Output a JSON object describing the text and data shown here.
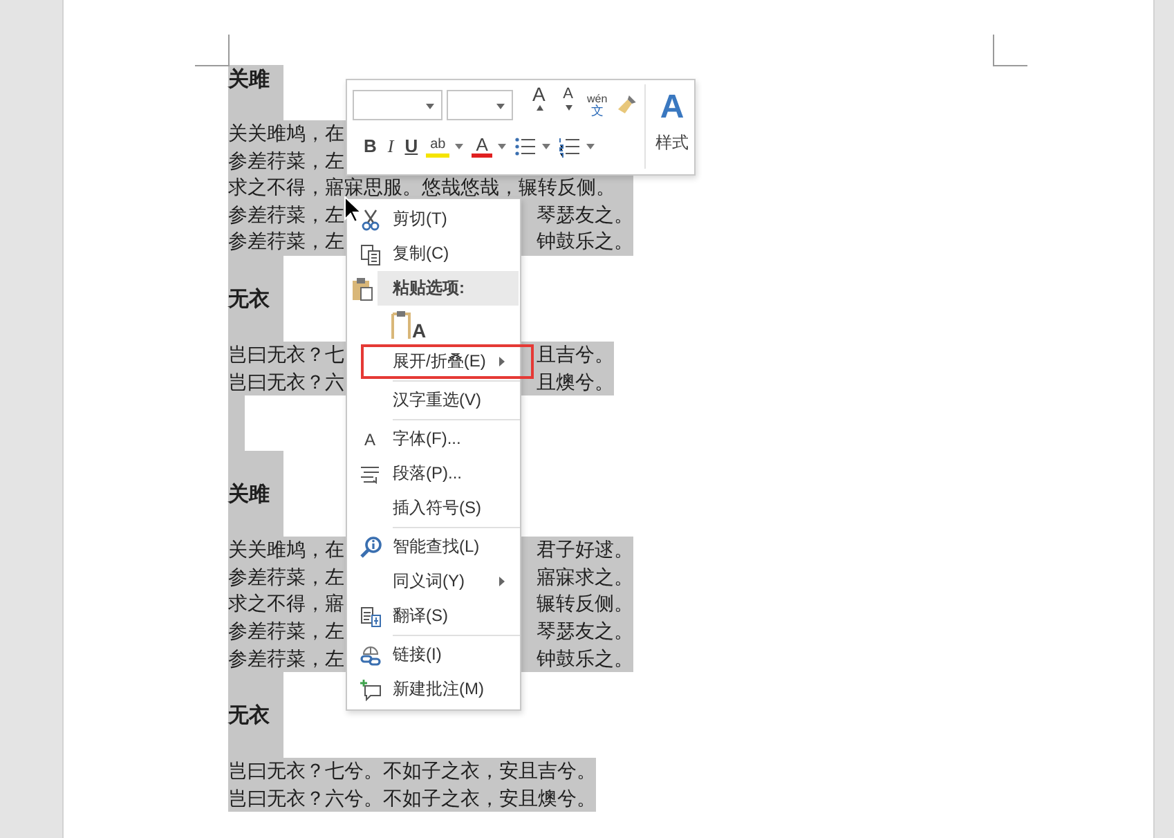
{
  "document": {
    "blocks": [
      {
        "kind": "heading",
        "text": "关雎"
      },
      {
        "kind": "paragraph",
        "lines": [
          {
            "left": "关关雎鸠，在"
          },
          {
            "left": "参差荇菜，左"
          },
          {
            "full": "求之不得，寤寐思服。悠哉悠哉，辗转反侧。"
          },
          {
            "left": "参差荇菜，左",
            "right": "琴瑟友之。"
          },
          {
            "left": "参差荇菜，左",
            "right": "钟鼓乐之。"
          }
        ]
      },
      {
        "kind": "heading",
        "text": "无衣"
      },
      {
        "kind": "paragraph",
        "lines": [
          {
            "left": "岂曰无衣？七",
            "right": "且吉兮。"
          },
          {
            "left": "岂曰无衣？六",
            "right": "且燠兮。"
          }
        ]
      },
      {
        "kind": "empty"
      },
      {
        "kind": "heading",
        "text": "关雎"
      },
      {
        "kind": "paragraph",
        "lines": [
          {
            "left": "关关雎鸠，在",
            "right": "君子好逑。"
          },
          {
            "left": "参差荇菜，左",
            "right": "寤寐求之。"
          },
          {
            "left": "求之不得，寤",
            "right": "辗转反侧。"
          },
          {
            "left": "参差荇菜，左",
            "right": "琴瑟友之。"
          },
          {
            "left": "参差荇菜，左",
            "right": "钟鼓乐之。"
          }
        ]
      },
      {
        "kind": "heading",
        "text": "无衣"
      },
      {
        "kind": "paragraph",
        "lines": [
          {
            "full": "岂曰无衣？七兮。不如子之衣，安且吉兮。"
          },
          {
            "full": "岂曰无衣？六兮。不如子之衣，安且燠兮。"
          }
        ]
      }
    ]
  },
  "mini_toolbar": {
    "row_1": [
      {
        "kind": "grow_font",
        "label": "A"
      },
      {
        "kind": "shrink_font",
        "label": "A"
      },
      {
        "kind": "phonetic_guide",
        "top": "wén",
        "bottom": "文"
      },
      {
        "kind": "format_painter"
      }
    ],
    "row_2": [
      {
        "kind": "bold",
        "label": "B"
      },
      {
        "kind": "italic",
        "label": "I"
      },
      {
        "kind": "underline",
        "label": "U"
      },
      {
        "kind": "highlight",
        "label": "ab"
      },
      {
        "kind": "font_color",
        "label": "A"
      },
      {
        "kind": "bullets"
      },
      {
        "kind": "numbering"
      }
    ],
    "styles": {
      "icon_char": "A",
      "label": "样式"
    }
  },
  "context_menu": {
    "items": [
      {
        "kind": "item",
        "label": "剪切(T)",
        "submenu": false,
        "marked": false
      },
      {
        "kind": "item",
        "label": "复制(C)",
        "submenu": false,
        "marked": false
      },
      {
        "kind": "header",
        "label": "粘贴选项:"
      },
      {
        "kind": "paste_options",
        "icon_char": "A"
      },
      {
        "kind": "item",
        "label": "展开/折叠(E)",
        "submenu": true,
        "marked": true
      },
      {
        "kind": "separator"
      },
      {
        "kind": "item",
        "label": "汉字重选(V)",
        "submenu": false,
        "marked": false
      },
      {
        "kind": "separator"
      },
      {
        "kind": "item",
        "label": "字体(F)...",
        "icon_char": "A",
        "submenu": false,
        "marked": false
      },
      {
        "kind": "item",
        "label": "段落(P)...",
        "submenu": false,
        "marked": false
      },
      {
        "kind": "item",
        "label": "插入符号(S)",
        "submenu": false,
        "marked": false
      },
      {
        "kind": "separator"
      },
      {
        "kind": "item",
        "label": "智能查找(L)",
        "submenu": false,
        "marked": false
      },
      {
        "kind": "item",
        "label": "同义词(Y)",
        "submenu": true,
        "marked": false
      },
      {
        "kind": "item",
        "label": "翻译(S)",
        "submenu": false,
        "marked": false
      },
      {
        "kind": "separator"
      },
      {
        "kind": "item",
        "label": "链接(I)",
        "submenu": false,
        "marked": false
      },
      {
        "kind": "item",
        "label": "新建批注(M)",
        "submenu": false,
        "marked": false
      }
    ]
  }
}
